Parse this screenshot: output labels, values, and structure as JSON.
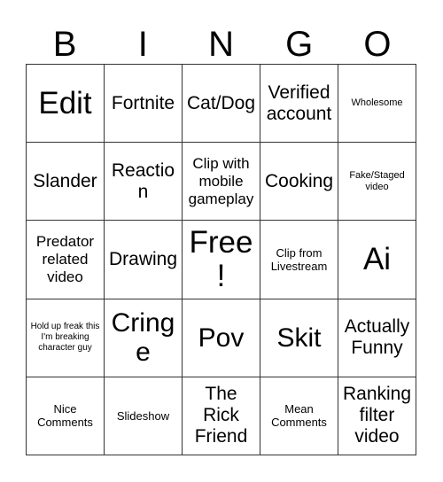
{
  "card": {
    "title": "BINGO",
    "header_letters": [
      "B",
      "I",
      "N",
      "G",
      "O"
    ],
    "colors": {
      "background": "#ffffff",
      "border": "#333333",
      "text": "#000000"
    },
    "grid": {
      "rows": 5,
      "columns": 5,
      "free_space_index": 12
    },
    "cells": [
      {
        "text": "Edit",
        "size": "xl"
      },
      {
        "text": "Fortnite",
        "size": "md"
      },
      {
        "text": "Cat/Dog",
        "size": "md"
      },
      {
        "text": "Verified account",
        "size": "md"
      },
      {
        "text": "Wholesome",
        "size": "xxs"
      },
      {
        "text": "Slander",
        "size": "md"
      },
      {
        "text": "Reaction",
        "size": "md"
      },
      {
        "text": "Clip with mobile gameplay",
        "size": "sm"
      },
      {
        "text": "Cooking",
        "size": "md"
      },
      {
        "text": "Fake/Staged video",
        "size": "xxs"
      },
      {
        "text": "Predator related video",
        "size": "sm"
      },
      {
        "text": "Drawing",
        "size": "md"
      },
      {
        "text": "Free!",
        "size": "xl"
      },
      {
        "text": "Clip from Livestream",
        "size": "xs"
      },
      {
        "text": "Ai",
        "size": "xl"
      },
      {
        "text": "Hold up freak this I'm breaking character guy",
        "size": "tiny"
      },
      {
        "text": "Cringe",
        "size": "lg"
      },
      {
        "text": "Pov",
        "size": "lg"
      },
      {
        "text": "Skit",
        "size": "lg"
      },
      {
        "text": "Actually Funny",
        "size": "md"
      },
      {
        "text": "Nice Comments",
        "size": "xs"
      },
      {
        "text": "Slideshow",
        "size": "xs"
      },
      {
        "text": "The Rick Friend",
        "size": "md"
      },
      {
        "text": "Mean Comments",
        "size": "xs"
      },
      {
        "text": "Ranking filter video",
        "size": "md"
      }
    ]
  }
}
